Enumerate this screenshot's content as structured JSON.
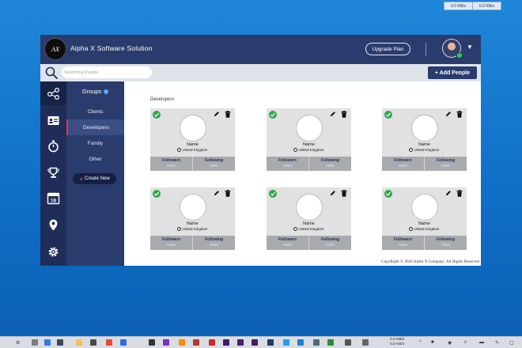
{
  "net_widget": {
    "download": "0.0 KB/s",
    "upload": "0.0 KB/s"
  },
  "header": {
    "logo_text": "AX",
    "brand": "Alpha X Software Solution",
    "upgrade_label": "Upgrade Plan"
  },
  "toolbar": {
    "search_placeholder": "Searching People",
    "add_people_label": "+ Add People"
  },
  "rail": {
    "icons": [
      "share-nodes-icon",
      "contact-card-icon",
      "stopwatch-icon",
      "trophy-icon",
      "calendar-icon",
      "location-pin-icon",
      "gear-icon"
    ],
    "calendar_day": "18"
  },
  "groups": {
    "title": "Groups",
    "items": [
      {
        "label": "Clients",
        "active": false
      },
      {
        "label": "Developers",
        "active": true
      },
      {
        "label": "Family",
        "active": false
      },
      {
        "label": "Other",
        "active": false
      }
    ],
    "create_label": "Create New"
  },
  "content": {
    "section_title": "Developers",
    "cards": [
      {
        "name": "Name",
        "location": "United Kingdom",
        "followers_label": "Followers",
        "followers": "0000",
        "following_label": "Following",
        "following": "0000"
      },
      {
        "name": "Name",
        "location": "United Kingdom",
        "followers_label": "Followers",
        "followers": "0000",
        "following_label": "Following",
        "following": "0000"
      },
      {
        "name": "Name",
        "location": "United Kingdom",
        "followers_label": "Followers",
        "followers": "0000",
        "following_label": "Following",
        "following": "0000"
      },
      {
        "name": "Name",
        "location": "United Kingdom",
        "followers_label": "Followers",
        "followers": "0000",
        "following_label": "Following",
        "following": "0000"
      },
      {
        "name": "Name",
        "location": "United Kingdom",
        "followers_label": "Followers",
        "followers": "0000",
        "following_label": "Following",
        "following": "0000"
      },
      {
        "name": "Name",
        "location": "United Kingdom",
        "followers_label": "Followers",
        "followers": "0000",
        "following_label": "Following",
        "following": "0000"
      }
    ],
    "copyright": "CopyRight © 2020 Alpha X Company. All Rights Reserved"
  },
  "taskbar": {
    "net_down": "0.0 KB/s",
    "net_up": "0.0 KB/s"
  },
  "colors": {
    "header": "#2a3c6d",
    "rail": "#1f2d58",
    "accent_red": "#e23b3b",
    "check_green": "#2fa84f"
  }
}
